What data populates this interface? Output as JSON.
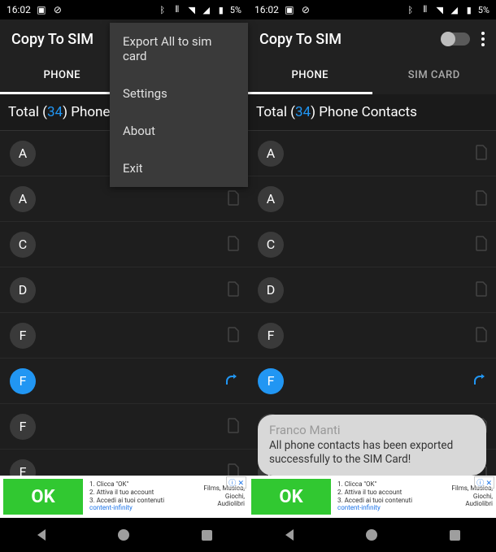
{
  "statusbar": {
    "time": "16:02",
    "battery": "5%"
  },
  "appbar": {
    "title": "Copy To SIM"
  },
  "tabs": {
    "phone": "PHONE",
    "sim": "SIM CARD"
  },
  "total": {
    "prefix": "Total (",
    "count": "34",
    "suffix": ") Phone Contacts"
  },
  "menu": {
    "export": "Export All to sim card",
    "settings": "Settings",
    "about": "About",
    "exit": "Exit"
  },
  "contacts": [
    "A",
    "A",
    "C",
    "D",
    "F",
    "F",
    "F",
    "F"
  ],
  "ad": {
    "ok": "OK",
    "l1": "1. Clicca \"OK\"",
    "l2": "2. Attiva il tuo account",
    "l3": "3. Accedi ai tuoi contenuti",
    "brand": "content-infinity",
    "r1": "Films, Musica,",
    "r2": "Giochi,",
    "r3": "Audiolibri"
  },
  "toast": {
    "name": "Franco Manti",
    "msg": "All phone contacts has been exported successfully to the SIM Card!"
  }
}
